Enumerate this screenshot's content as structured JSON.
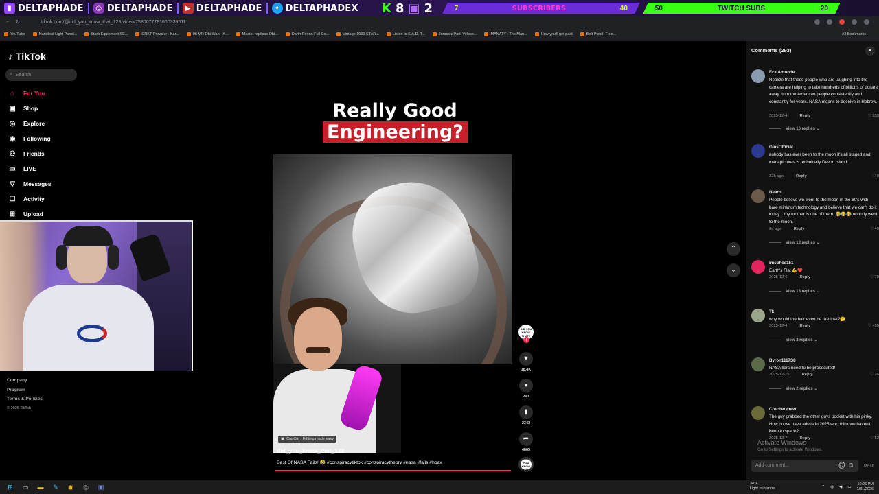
{
  "banner": {
    "socials": [
      "DELTAPHADE",
      "DELTAPHADE",
      "DELTAPHADE",
      "DELTAPHADEX"
    ],
    "count_left": "8",
    "count_right": "2",
    "subs_current": "7",
    "subs_label": "SUBSCRIBERS",
    "subs_goal": "40",
    "twitch_current": "50",
    "twitch_label": "TWITCH SUBS",
    "twitch_goal": "20"
  },
  "browser": {
    "url": "tiktok.com/@did_you_know_that_123/video/7580077781660339511",
    "bookmarks": [
      "YouTube",
      "Nanoleaf Light Panel...",
      "Stark Equipment SE...",
      "CRKT Provoke - Kar...",
      "06 MR Obi Wan - K...",
      "Master replicas Obi...",
      "Darth Revan Full Co...",
      "Vintage 1999 STAR...",
      "Listen to S.A.D. T...",
      "Jurassic Park Veloce...",
      "MANATY : The Man...",
      "How you'll get paid",
      "Bolt Pistol -Free..."
    ],
    "all_bookmarks": "All Bookmarks"
  },
  "tiktok": {
    "logo": "TikTok",
    "search_placeholder": "Search",
    "nav": [
      "For You",
      "Shop",
      "Explore",
      "Following",
      "Friends",
      "LIVE",
      "Messages",
      "Activity",
      "Upload"
    ],
    "footer": [
      "Company",
      "Program",
      "Terms & Policies"
    ],
    "copyright": "© 2026 TikTok"
  },
  "video": {
    "title_line1": "Really Good",
    "title_line2": "Engineering?",
    "capcut": "CapCut · Editing made easy",
    "author": "did_you_know_that_123",
    "caption": "Best Of NASA Fails! 🤣 #conspiracytiktok #conspiracytheory #nasa #fails #hoax",
    "avatar_text": "DID YOU KNOW THAT?",
    "likes": "18.4K",
    "comments": "293",
    "saves": "2342",
    "shares": "4865"
  },
  "comments": {
    "header": "Comments (293)",
    "items": [
      {
        "user": "Eck Amonde",
        "text": "Realize that these people who are laughing into the camera are helping to take hundreds of billions of dollars away from the American people consistently and constantly for years. NASA means to deceive in Hebrew.",
        "date": "2025-12-4",
        "reply": "Reply",
        "likes": "259",
        "view": "View 16 replies"
      },
      {
        "user": "GiosOfficial",
        "text": "nobody has ever been to the moon it's all staged and mars pictures is technically Devon island.",
        "date": "22h ago",
        "reply": "Reply",
        "likes": "0",
        "view": ""
      },
      {
        "user": "Beans",
        "text": "People believe we went to the moon in the 60's with bare minimum technology and believe that we can't do it today... my mother is one of them. 😂😂😂 nobody went to the moon.",
        "date": "6d ago",
        "reply": "Reply",
        "likes": "49",
        "view": "View 12 replies"
      },
      {
        "user": "imcphee151",
        "text": "Earth's Flat 💪❤️",
        "date": "2025-12-6",
        "reply": "Reply",
        "likes": "79",
        "view": "View 13 replies"
      },
      {
        "user": "Tk",
        "text": "why would the hair even be like that?🤔",
        "date": "2025-12-4",
        "reply": "Reply",
        "likes": "455",
        "view": "View 2 replies"
      },
      {
        "user": "Byron1117S8",
        "text": "NASA liars need to be prosecuted!",
        "date": "2025-12-15",
        "reply": "Reply",
        "likes": "24",
        "view": "View 2 replies"
      },
      {
        "user": "Crochet crew",
        "text": "The guy grabbed the other guys pocket with his pinky. How do we have adults in 2025 who think we haven't been to space?",
        "date": "2025-12-7",
        "reply": "Reply",
        "likes": "52",
        "view": ""
      }
    ],
    "add_placeholder": "Add comment...",
    "post": "Post"
  },
  "windows": {
    "activate": "Activate Windows",
    "activate_sub": "Go to Settings to activate Windows.",
    "weather_temp": "34°F",
    "weather_desc": "Light rain/snow",
    "time": "10:26 PM",
    "date": "1/31/2026"
  },
  "colors": {
    "accent": "#fe2c55",
    "panel": "#121212"
  }
}
